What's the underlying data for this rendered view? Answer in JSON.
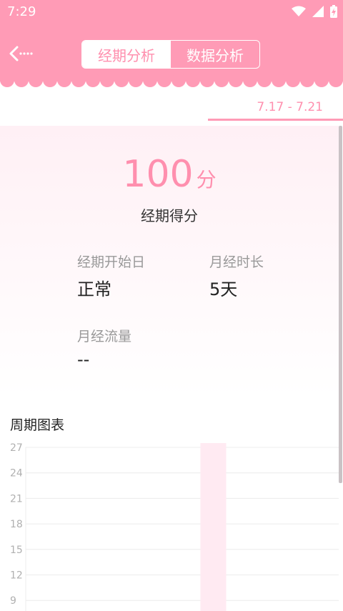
{
  "status": {
    "time": "7:29"
  },
  "header": {
    "back_icon": "back-arrow-icon",
    "tabs": [
      {
        "label": "经期分析",
        "active": true
      },
      {
        "label": "数据分析",
        "active": false
      }
    ]
  },
  "date_range": "7.17 - 7.21",
  "score": {
    "value": "100",
    "unit": "分",
    "label": "经期得分"
  },
  "stats": [
    {
      "label": "经期开始日",
      "value": "正常"
    },
    {
      "label": "月经时长",
      "value": "5天"
    },
    {
      "label": "月经流量",
      "value": "--"
    }
  ],
  "chart_title": "周期图表",
  "chart_data": {
    "type": "bar",
    "yticks": [
      "27",
      "24",
      "21",
      "18",
      "15",
      "12",
      "9"
    ],
    "ylim": [
      9,
      27
    ],
    "categories": [
      "",
      "",
      "",
      "",
      "",
      ""
    ],
    "values": [
      null,
      null,
      null,
      27,
      null,
      null
    ],
    "colors": {
      "bar": "#ffeaf2",
      "grid": "#ececec",
      "tick": "#b0b0b0"
    }
  },
  "colors": {
    "accent": "#ff9bb6",
    "accent_text": "#ff8fae"
  }
}
